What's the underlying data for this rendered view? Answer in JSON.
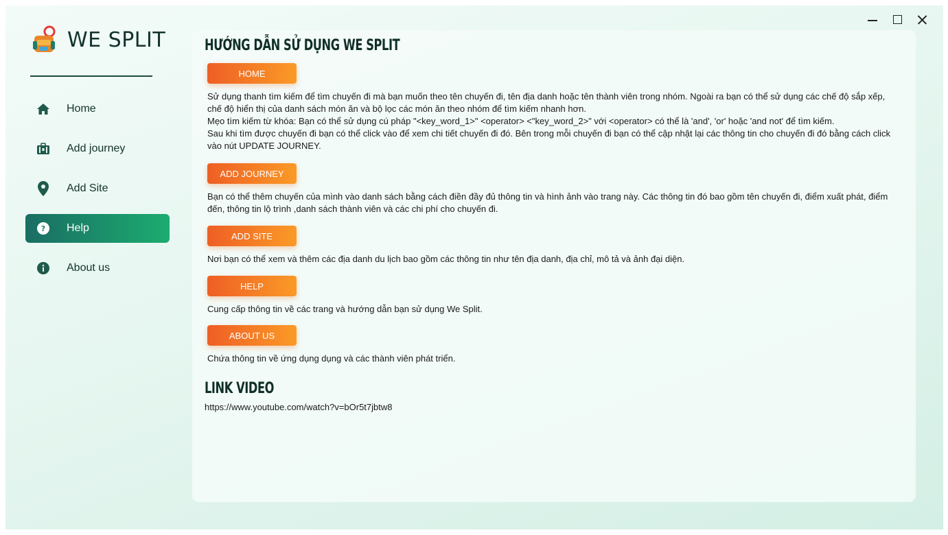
{
  "app": {
    "name": "WE SPLIT"
  },
  "sidebar": {
    "items": [
      {
        "label": "Home",
        "icon": "home-icon"
      },
      {
        "label": "Add journey",
        "icon": "briefcase-icon"
      },
      {
        "label": "Add Site",
        "icon": "map-pin-icon"
      },
      {
        "label": "Help",
        "icon": "question-icon",
        "active": true
      },
      {
        "label": "About us",
        "icon": "info-icon"
      }
    ]
  },
  "help": {
    "title": "HƯỚNG DẪN SỬ DỤNG WE SPLIT",
    "sections": [
      {
        "label": "HOME",
        "text": "Sử dụng thanh tìm kiếm để tìm chuyến đi mà bạn muốn theo tên chuyến đi, tên địa danh hoặc tên thành viên trong nhóm. Ngoài ra bạn có thể sử dụng các chế độ sắp xếp, chế độ hiển thị của danh sách món ăn và bộ lọc các món ăn theo nhóm để tìm kiếm nhanh hơn.\nMẹo tìm kiếm từ khóa: Bạn có thể sử dụng cú pháp \"<key_word_1>\" <operator> <\"key_word_2>\" với <operator> có thể là 'and', 'or' hoặc 'and not' để tìm kiếm.\nSau khi tìm được chuyến đi bạn có thể click vào để xem chi tiết chuyến đi đó. Bên trong mỗi chuyến đi bạn có thể cập nhật lại các thông tin cho chuyến đi đó bằng cách click vào nút UPDATE JOURNEY."
      },
      {
        "label": "ADD JOURNEY",
        "text": "Bạn có thể thêm chuyến của mình vào danh sách bằng cách điền đầy đủ thông tin và hình ảnh vào trang này. Các thông tin đó bao gồm tên chuyến đi, điểm xuất phát, điểm đến, thông tin lộ trình ,danh sách thành viên và các chi phí cho chuyến đi."
      },
      {
        "label": "ADD SITE",
        "text": "Nơi bạn có thể xem và thêm các địa danh du lịch bao gồm các thông tin như tên địa danh, địa chỉ, mô tả và ảnh đại diện."
      },
      {
        "label": "HELP",
        "text": "Cung cấp thông tin về các trang và hướng dẫn bạn sử dụng We Split."
      },
      {
        "label": "ABOUT US",
        "text": "Chứa thông tin về ứng dụng dụng và các thành viên phát triển."
      }
    ],
    "video_title": "LINK VIDEO",
    "video_url": "https://www.youtube.com/watch?v=bOr5t7jbtw8"
  },
  "colors": {
    "accent_green": "#1cac70",
    "accent_orange": "#f57f26",
    "text_dark": "#12332b"
  }
}
